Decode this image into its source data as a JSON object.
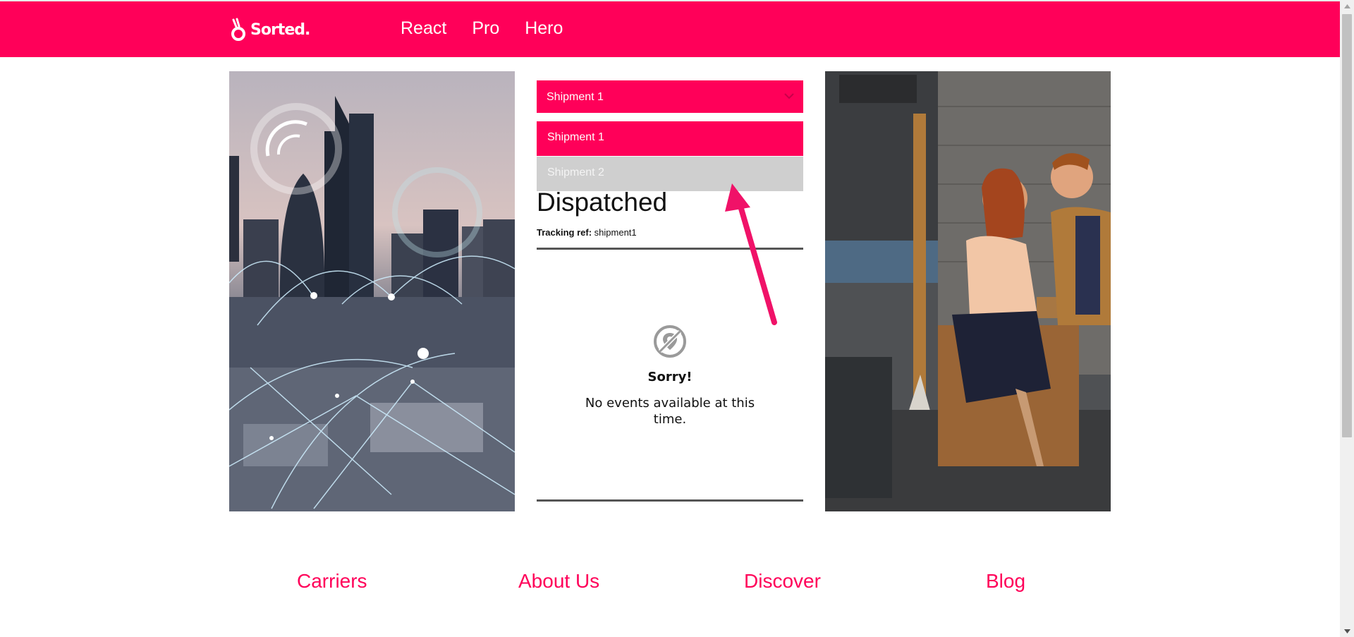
{
  "header": {
    "logo_text": "Sorted.",
    "nav": [
      "React",
      "Pro",
      "Hero"
    ]
  },
  "shipment_select": {
    "selected": "Shipment 1",
    "options": [
      "Shipment 1",
      "Shipment 2"
    ]
  },
  "shipment": {
    "status": "Dispatched",
    "tracking_label": "Tracking ref:",
    "tracking_value": "shipment1"
  },
  "events": {
    "empty_title": "Sorry!",
    "empty_message": "No events available at this time."
  },
  "footer": {
    "links": [
      "Carriers",
      "About Us",
      "Discover",
      "Blog"
    ]
  },
  "colors": {
    "brand": "#ff0059",
    "option_inactive": "#cfcfcf"
  }
}
